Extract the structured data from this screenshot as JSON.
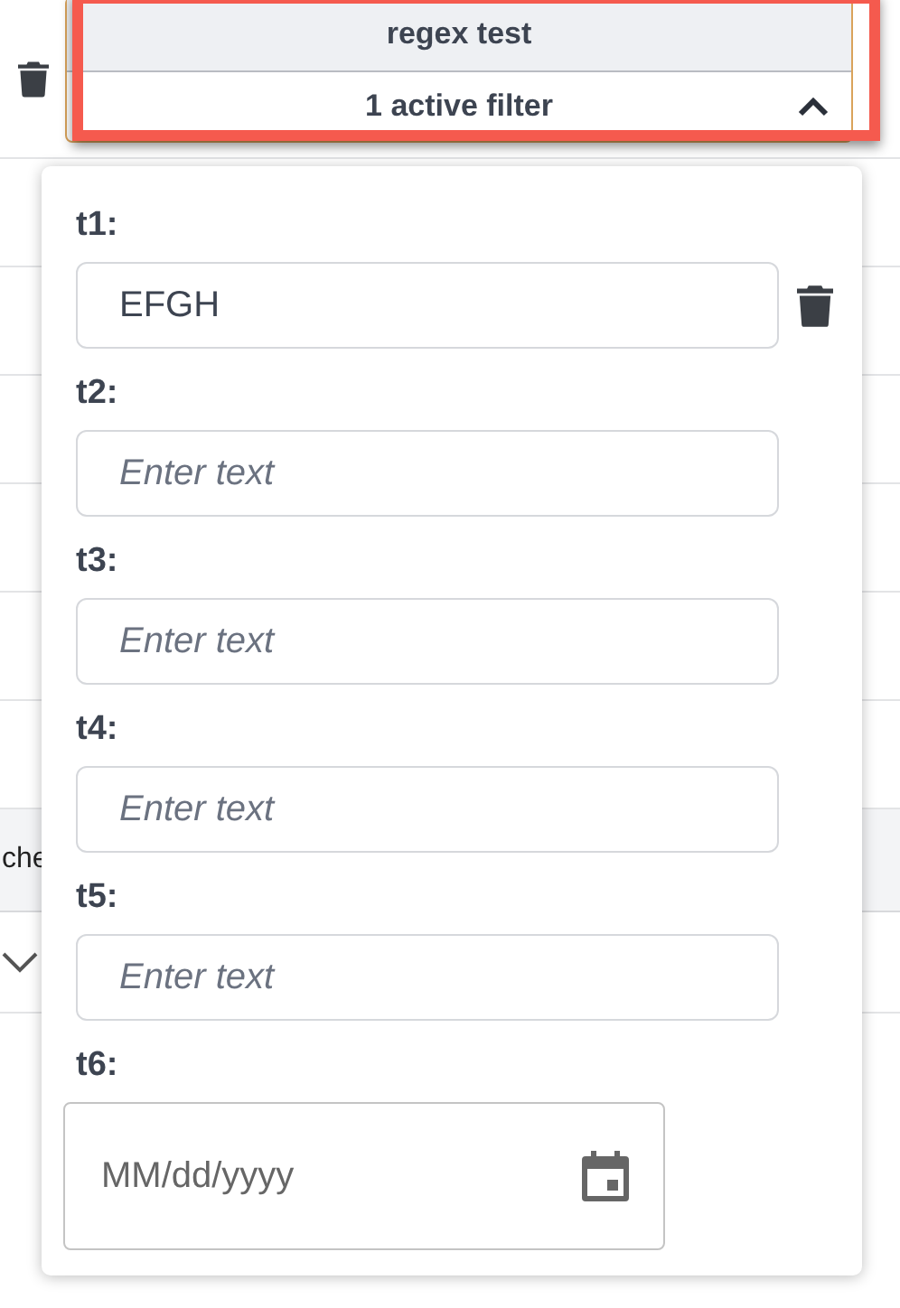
{
  "header": {
    "title": "regex test",
    "summary": "1 active filter",
    "expanded": true
  },
  "background": {
    "band_text": "che",
    "row_expanded": false
  },
  "filters": [
    {
      "label": "t1:",
      "kind": "text",
      "value": "EFGH",
      "removable": true
    },
    {
      "label": "t2:",
      "kind": "text",
      "placeholder": "Enter text",
      "removable": false
    },
    {
      "label": "t3:",
      "kind": "text",
      "placeholder": "Enter text",
      "removable": false
    },
    {
      "label": "t4:",
      "kind": "text",
      "placeholder": "Enter text",
      "removable": false
    },
    {
      "label": "t5:",
      "kind": "text",
      "placeholder": "Enter text",
      "removable": false
    },
    {
      "label": "t6:",
      "kind": "date",
      "placeholder": "MM/dd/yyyy",
      "removable": false
    }
  ]
}
